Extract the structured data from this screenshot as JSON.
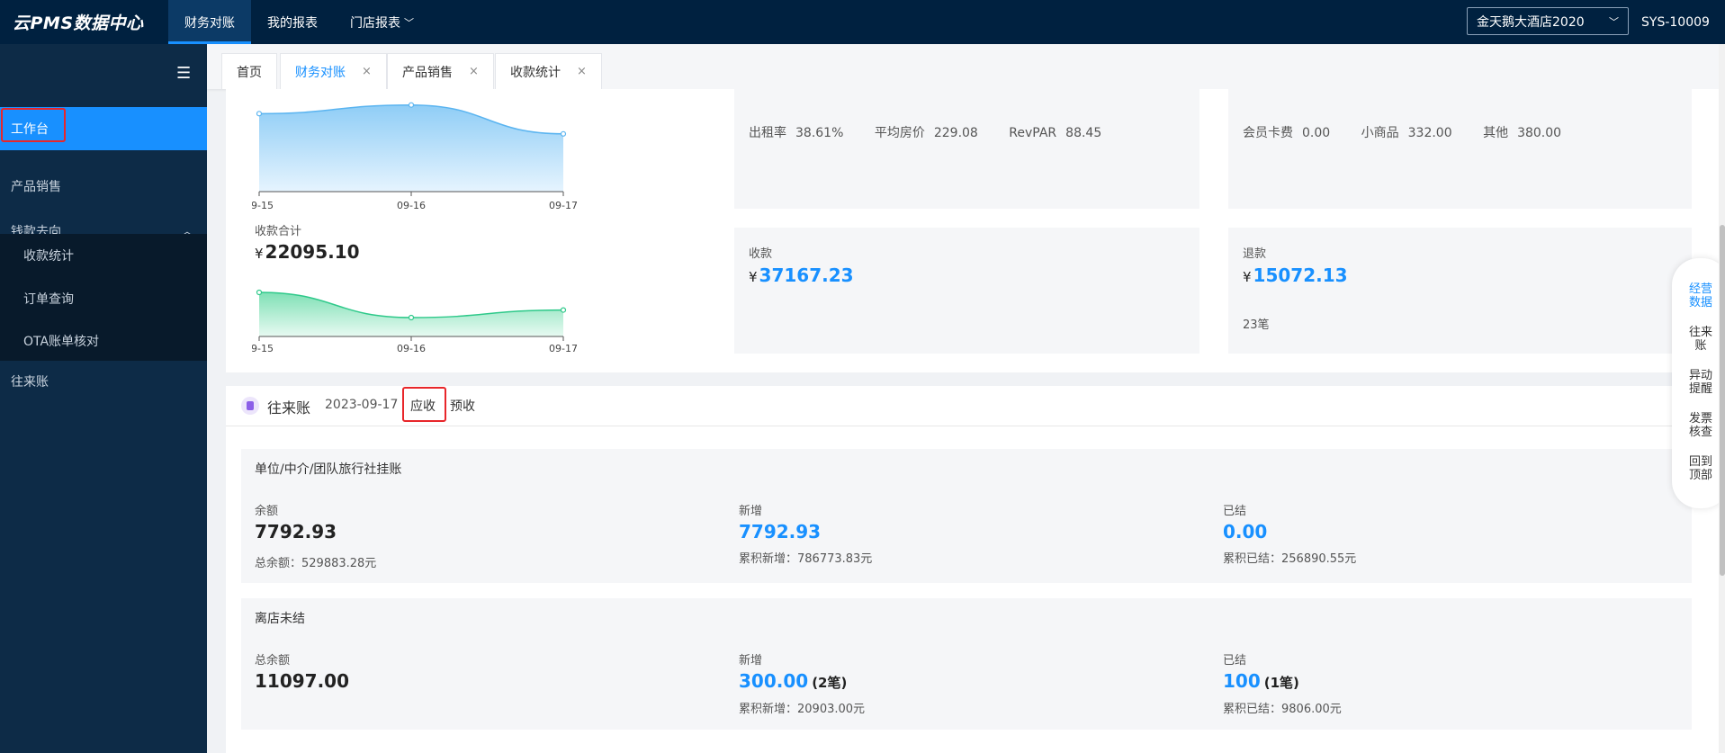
{
  "app": {
    "logo": "云PMS数据中心"
  },
  "topnav": [
    {
      "label": "财务对账",
      "active": true
    },
    {
      "label": "我的报表",
      "active": false
    },
    {
      "label": "门店报表",
      "active": false
    }
  ],
  "header": {
    "hotel": "金天鹅大酒店2020",
    "sys_id": "SYS-10009"
  },
  "sidebar": {
    "items": [
      {
        "label": "工作台"
      },
      {
        "label": "产品销售"
      },
      {
        "label": "钱款去向"
      },
      {
        "label": "收款统计"
      },
      {
        "label": "订单查询"
      },
      {
        "label": "OTA账单核对"
      },
      {
        "label": "往来账"
      }
    ]
  },
  "tabs": [
    {
      "label": "首页"
    },
    {
      "label": "财务对账"
    },
    {
      "label": "产品销售"
    },
    {
      "label": "收款统计"
    }
  ],
  "stats": {
    "occupancy_label": "出租率",
    "occupancy": "38.61%",
    "adr_label": "平均房价",
    "adr": "229.08",
    "revpar_label": "RevPAR",
    "revpar": "88.45",
    "member_label": "会员卡费",
    "member": "0.00",
    "goods_label": "小商品",
    "goods": "332.00",
    "other_label": "其他",
    "other": "380.00",
    "receipt_label": "收款",
    "receipt": "37167.23",
    "refund_label": "退款",
    "refund": "15072.13",
    "refund_count": "23笔",
    "collect_total_label": "收款合计",
    "collect_total": "22095.10",
    "yen": "¥"
  },
  "ledger": {
    "title": "往来账",
    "date": "2023-09-17",
    "tab_receivable": "应收",
    "tab_advance": "预收",
    "section1": {
      "title": "单位/中介/团队旅行社挂账",
      "balance_label": "余额",
      "balance": "7792.93",
      "balance_total": "总余额：529883.28元",
      "new_label": "新增",
      "new": "7792.93",
      "new_total": "累积新增：786773.83元",
      "settled_label": "已结",
      "settled": "0.00",
      "settled_total": "累积已结：256890.55元"
    },
    "section2": {
      "title": "离店未结",
      "balance_label": "总余额",
      "balance": "11097.00",
      "new_label": "新增",
      "new": "300.00",
      "new_count": "(2笔)",
      "new_total": "累积新增：20903.00元",
      "settled_label": "已结",
      "settled": "100",
      "settled_count": "(1笔)",
      "settled_total": "累积已结：9806.00元"
    }
  },
  "float_nav": [
    "经营\n数据",
    "往来\n账",
    "异动\n提醒",
    "发票\n核查",
    "回到\n顶部"
  ],
  "colors": {
    "accent": "#1890ff",
    "topbar": "#002140",
    "sidebar": "#0d2b47",
    "highlight": "#e8262a"
  },
  "chart_data": [
    {
      "type": "area",
      "x": [
        "09-15",
        "09-16",
        "09-17"
      ],
      "series": [
        {
          "values": [
            81,
            90,
            60
          ]
        }
      ],
      "ylim": [
        0,
        100
      ]
    },
    {
      "type": "area",
      "title": "收款合计",
      "x": [
        "09-15",
        "09-16",
        "09-17"
      ],
      "series": [
        {
          "values": [
            70,
            30,
            42
          ]
        }
      ],
      "ylim": [
        0,
        100
      ]
    }
  ]
}
